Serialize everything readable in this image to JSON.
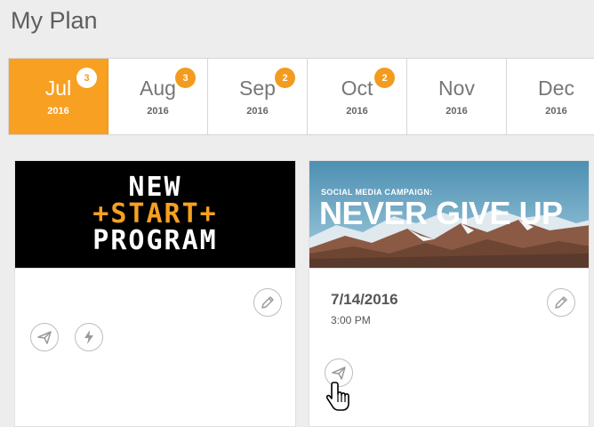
{
  "page": {
    "title": "My Plan"
  },
  "months": [
    {
      "name": "Jul",
      "year": "2016",
      "badge": "3",
      "active": true
    },
    {
      "name": "Aug",
      "year": "2016",
      "badge": "3",
      "active": false
    },
    {
      "name": "Sep",
      "year": "2016",
      "badge": "2",
      "active": false
    },
    {
      "name": "Oct",
      "year": "2016",
      "badge": "2",
      "active": false
    },
    {
      "name": "Nov",
      "year": "2016",
      "badge": "",
      "active": false
    },
    {
      "name": "Dec",
      "year": "2016",
      "badge": "",
      "active": false
    }
  ],
  "cards": [
    {
      "banner": {
        "line1": "NEW",
        "line2": "+START+",
        "line3": "PROGRAM"
      },
      "icons": [
        "edit-icon",
        "send-icon",
        "lightning-icon"
      ]
    },
    {
      "banner": {
        "label": "SOCIAL MEDIA CAMPAIGN:",
        "headline": "NEVER GIVE UP"
      },
      "date": "7/14/2016",
      "time": "3:00 PM",
      "icons": [
        "edit-icon",
        "send-icon"
      ]
    }
  ],
  "colors": {
    "accent": "#f7a021",
    "badge": "#f29b1e",
    "text": "#5e5e5e"
  }
}
